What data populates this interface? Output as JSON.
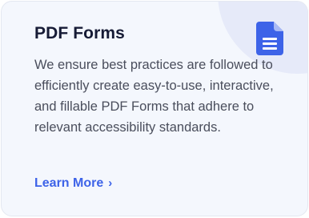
{
  "card": {
    "title": "PDF Forms",
    "description": "We ensure best practices are followed to efficiently create easy-to-use, interactive, and fillable PDF Forms that adhere to relevant accessibility standards.",
    "link_label": "Learn More",
    "link_chevron": "›",
    "icon": "document-icon"
  },
  "colors": {
    "card_background": "#f4f7fd",
    "accent": "#3d63e8",
    "title": "#161b35",
    "body_text": "#4a4e5c",
    "icon_circle": "#e6eaf9"
  }
}
